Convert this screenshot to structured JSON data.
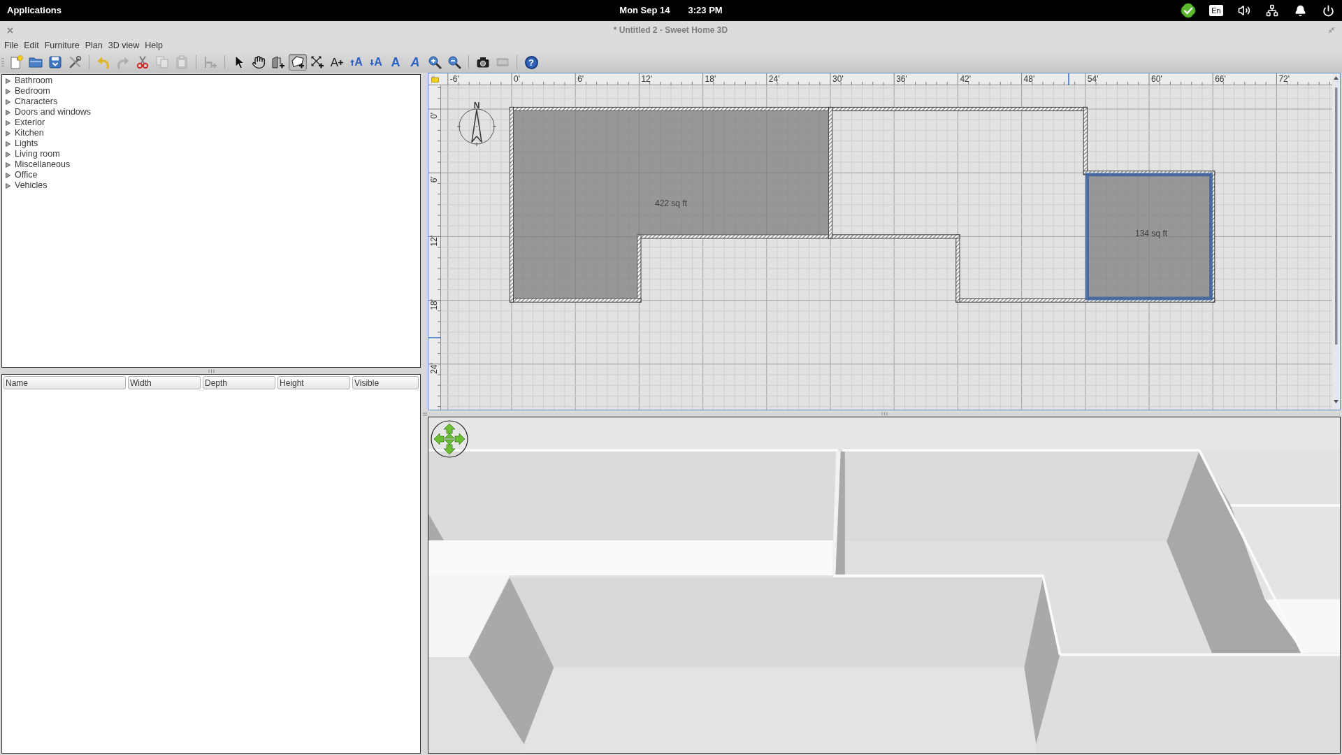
{
  "top_bar": {
    "menu": "Applications",
    "date": "Mon Sep 14",
    "time": "3:23 PM",
    "keyboard_layout": "En"
  },
  "window": {
    "title": "* Untitled 2 - Sweet Home 3D"
  },
  "menu_bar": [
    "File",
    "Edit",
    "Furniture",
    "Plan",
    "3D view",
    "Help"
  ],
  "toolbar": [
    {
      "kind": "new",
      "disabled": false,
      "selected": false
    },
    {
      "kind": "open",
      "disabled": false,
      "selected": false
    },
    {
      "kind": "save",
      "disabled": false,
      "selected": false
    },
    {
      "kind": "preferences",
      "disabled": false,
      "selected": false
    },
    {
      "kind": "separator"
    },
    {
      "kind": "undo",
      "disabled": false,
      "selected": false
    },
    {
      "kind": "redo",
      "disabled": true,
      "selected": false
    },
    {
      "kind": "cut",
      "disabled": false,
      "selected": false
    },
    {
      "kind": "copy",
      "disabled": true,
      "selected": false
    },
    {
      "kind": "paste",
      "disabled": true,
      "selected": false
    },
    {
      "kind": "separator"
    },
    {
      "kind": "add_furniture",
      "disabled": true,
      "selected": false
    },
    {
      "kind": "separator"
    },
    {
      "kind": "select",
      "disabled": false,
      "selected": false
    },
    {
      "kind": "pan",
      "disabled": false,
      "selected": false
    },
    {
      "kind": "create_walls",
      "disabled": false,
      "selected": false
    },
    {
      "kind": "create_rooms",
      "disabled": false,
      "selected": true
    },
    {
      "kind": "create_dimensions",
      "disabled": false,
      "selected": false
    },
    {
      "kind": "add_text",
      "glyph": "A",
      "disabled": false,
      "selected": false
    },
    {
      "kind": "increase_text",
      "glyph": "A",
      "disabled": false,
      "selected": false
    },
    {
      "kind": "decrease_text",
      "glyph": "A",
      "disabled": false,
      "selected": false
    },
    {
      "kind": "bold",
      "glyph": "A",
      "disabled": false,
      "selected": false
    },
    {
      "kind": "italic",
      "glyph": "A",
      "disabled": false,
      "selected": false
    },
    {
      "kind": "zoom_in",
      "disabled": false,
      "selected": false
    },
    {
      "kind": "zoom_out",
      "disabled": false,
      "selected": false
    },
    {
      "kind": "separator"
    },
    {
      "kind": "photo",
      "disabled": false,
      "selected": false
    },
    {
      "kind": "video",
      "disabled": true,
      "selected": false
    },
    {
      "kind": "separator"
    },
    {
      "kind": "help",
      "glyph": "?",
      "disabled": false,
      "selected": false
    }
  ],
  "catalog": [
    {
      "label": "Bathroom",
      "expanded": false
    },
    {
      "label": "Bedroom",
      "expanded": false
    },
    {
      "label": "Characters",
      "expanded": false
    },
    {
      "label": "Doors and windows",
      "expanded": false
    },
    {
      "label": "Exterior",
      "expanded": false
    },
    {
      "label": "Kitchen",
      "expanded": false
    },
    {
      "label": "Lights",
      "expanded": false
    },
    {
      "label": "Living room",
      "expanded": false
    },
    {
      "label": "Miscellaneous",
      "expanded": false
    },
    {
      "label": "Office",
      "expanded": false
    },
    {
      "label": "Vehicles",
      "expanded": false
    }
  ],
  "furniture_table": {
    "columns": [
      "Name",
      "Width",
      "Depth",
      "Height",
      "Visible"
    ]
  },
  "plan": {
    "ruler_x": [
      "-6'",
      "0'",
      "6'",
      "12'",
      "18'",
      "24'",
      "30'",
      "36'",
      "42'",
      "48'",
      "54'",
      "60'",
      "66'",
      "72'"
    ],
    "ruler_y": [
      "0'",
      "6'",
      "12'",
      "18'",
      "24'"
    ],
    "compass": "N",
    "rooms": [
      {
        "area": "422 sq ft",
        "selected": false
      },
      {
        "area": "134 sq ft",
        "selected": true
      }
    ]
  }
}
